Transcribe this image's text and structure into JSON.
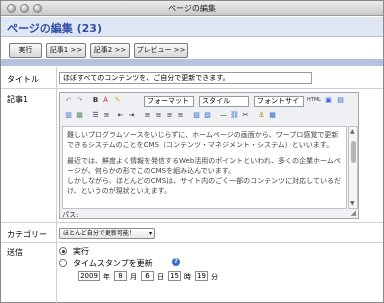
{
  "window": {
    "title": "ページの編集"
  },
  "page": {
    "heading": "ページの編集 (23)"
  },
  "toolbar": {
    "run": "実行",
    "article1": "記事1 >>",
    "article2": "記事2 >>",
    "preview": "プレビュー >>"
  },
  "form": {
    "title_label": "タイトル",
    "title_value": "ほぼすべてのコンテンツを、ご自分で更新できます。",
    "article_label": "記事1",
    "editor": {
      "format": "フォーマット",
      "style": "スタイル",
      "font_size": "フォントサイ",
      "html": "HTML",
      "paragraph1": "難しいプログラムソースをいじらずに、ホームページの画面から、ワープロ感覚で更新できるシステムのことをCMS（コンテンツ・マネジメント・システム）といいます。",
      "paragraph2": "最近では、鮮度よく情報を発信するWeb活用のポイントといわれ、多くの企業ホームページが、何らかの形でこのCMSを組み込んでいます。",
      "paragraph3": "しかしながら、ほとんどのCMSは、サイト内のごく一部のコンテンツに対応しているだけ、というのが現状といえます。",
      "path": "パス:"
    },
    "category_label": "カテゴリー",
    "category_value": "ほとんど自分で更新可能！",
    "send_label": "送信",
    "run_option": "実行",
    "timestamp_option": "タイムスタンプを更新",
    "help": "?",
    "year": "2009",
    "year_unit": "年",
    "month": "8",
    "month_unit": "月",
    "day": "6",
    "day_unit": "日",
    "hour": "15",
    "hour_unit": "時",
    "minute": "19",
    "minute_unit": "分"
  }
}
